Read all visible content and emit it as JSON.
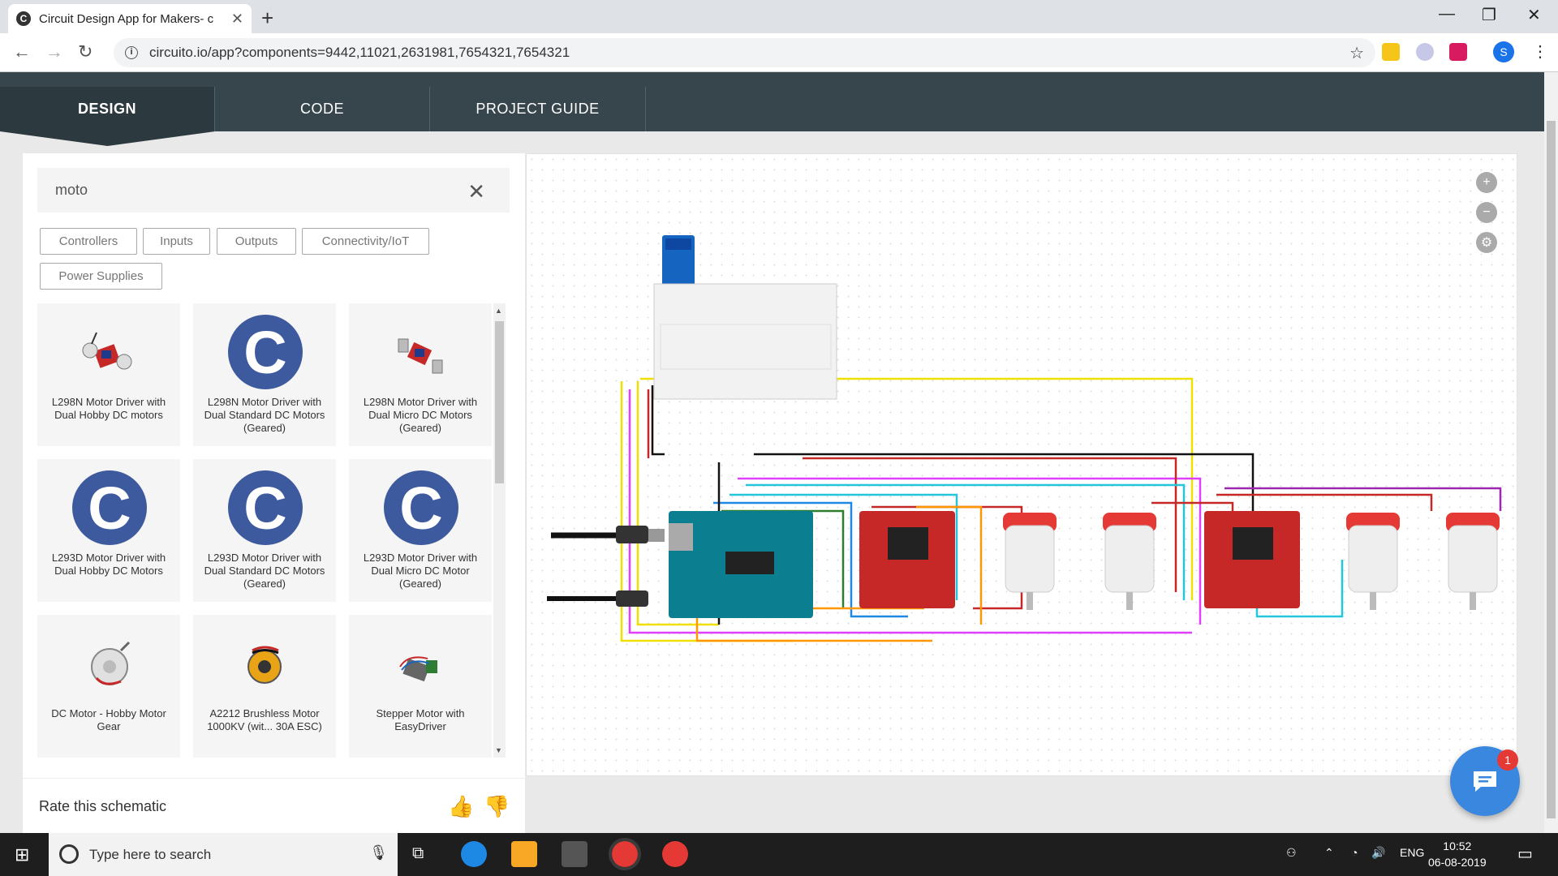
{
  "browser": {
    "tab_title": "Circuit Design App for Makers- c",
    "url": "circuito.io/app?components=9442,11021,2631981,7654321,7654321"
  },
  "app": {
    "tabs": [
      {
        "label": "DESIGN"
      },
      {
        "label": "CODE"
      },
      {
        "label": "PROJECT GUIDE"
      }
    ]
  },
  "search": {
    "value": "moto"
  },
  "filters": [
    "Controllers",
    "Inputs",
    "Outputs",
    "Connectivity/IoT",
    "Power Supplies"
  ],
  "components": [
    {
      "label": "L298N Motor Driver with Dual Hobby DC motors",
      "icon": "motor-driver-board"
    },
    {
      "label": "L298N Motor Driver with Dual Standard DC Motors (Geared)",
      "icon": "circuito-logo"
    },
    {
      "label": "L298N Motor Driver with Dual Micro DC Motors (Geared)",
      "icon": "motor-driver-board"
    },
    {
      "label": "L293D Motor Driver with Dual Hobby DC Motors",
      "icon": "circuito-logo"
    },
    {
      "label": "L293D Motor Driver with Dual Standard DC Motors (Geared)",
      "icon": "circuito-logo"
    },
    {
      "label": "L293D Motor Driver with Dual Micro DC Motor (Geared)",
      "icon": "circuito-logo"
    },
    {
      "label": "DC Motor - Hobby Motor Gear",
      "icon": "dc-motor"
    },
    {
      "label": "A2212 Brushless Motor 1000KV (wit... 30A ESC)",
      "icon": "brushless-motor"
    },
    {
      "label": "Stepper Motor with EasyDriver",
      "icon": "stepper-motor"
    }
  ],
  "rate": {
    "label": "Rate this schematic"
  },
  "chat": {
    "badge": "1"
  },
  "taskbar": {
    "search_placeholder": "Type here to search",
    "lang": "ENG",
    "time": "10:52",
    "date": "06-08-2019"
  },
  "colors": {
    "header": "#37454d",
    "accent": "#3a87e0",
    "logo": "#3d5a9e"
  }
}
